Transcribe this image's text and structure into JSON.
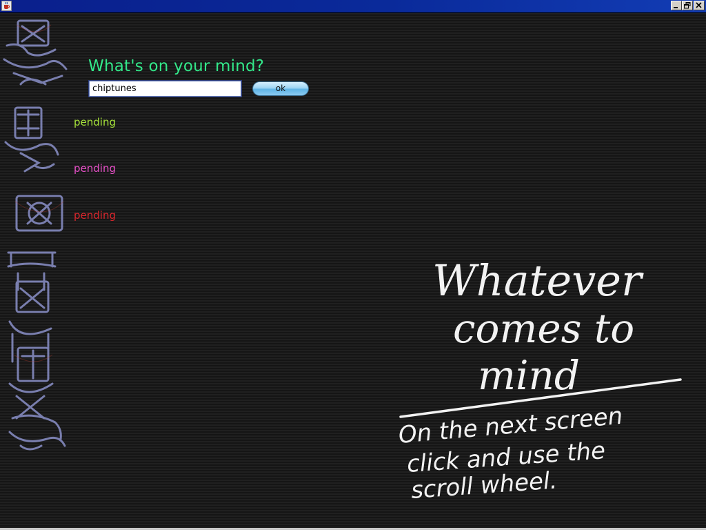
{
  "window": {
    "title": "",
    "controls": [
      "minimize-icon",
      "restore-icon",
      "close-icon"
    ]
  },
  "prompt": {
    "label": "What's on your mind?",
    "color": "#33e88a"
  },
  "search": {
    "value": "chiptunes",
    "placeholder": ""
  },
  "ok_button": {
    "label": "ok"
  },
  "statuses": [
    {
      "text": "pending",
      "color": "#a6e23a"
    },
    {
      "text": "pending",
      "color": "#e54fc6"
    },
    {
      "text": "pending",
      "color": "#d8262c"
    }
  ],
  "note": {
    "line1": "Whatever",
    "line2": "comes to",
    "line3": "mind",
    "line4": "On the next screen",
    "line5": "click and use the",
    "line6": "scroll wheel."
  },
  "icons": {
    "app": "java-coffee-cup-icon",
    "decoration": "tribal-totem-artwork"
  }
}
